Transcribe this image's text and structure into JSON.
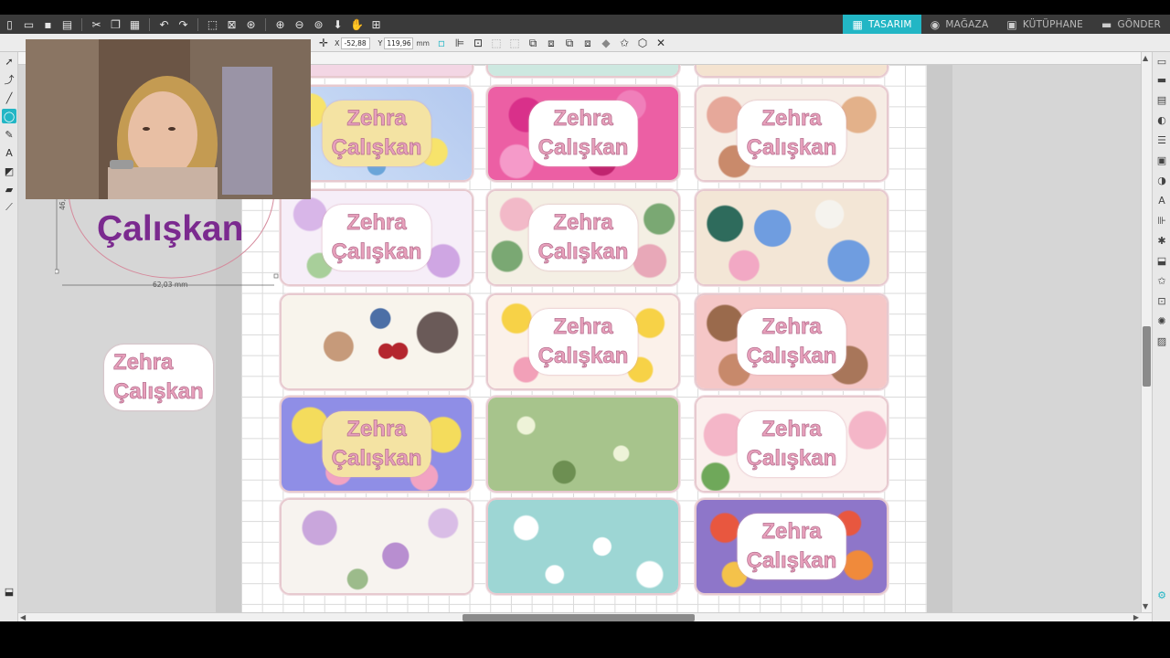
{
  "nav": {
    "tabs": [
      {
        "label": "TASARIM",
        "icon": "grid-icon",
        "active": true
      },
      {
        "label": "MAĞAZA",
        "icon": "store-icon",
        "active": false
      },
      {
        "label": "KÜTÜPHANE",
        "icon": "library-icon",
        "active": false
      },
      {
        "label": "GÖNDER",
        "icon": "send-icon",
        "active": false
      }
    ]
  },
  "toolbar": {
    "x_label": "X",
    "x_value": "-52,88",
    "y_label": "Y",
    "y_value": "119,96",
    "unit": "mm"
  },
  "canvas": {
    "labels": [
      {
        "line1": "Zehra",
        "line2": "Çalışkan"
      }
    ],
    "big_text": "Çalışkan",
    "side_label": {
      "line1": "Zehra",
      "line2": "Çalışkan"
    },
    "dim_width": "62,03 mm",
    "dim_height": "46,7"
  },
  "colors": {
    "accent": "#22b6c5",
    "label_pink": "#e7a0bb",
    "label_stroke": "#b46e8e",
    "big_text": "#7b2a8f"
  }
}
